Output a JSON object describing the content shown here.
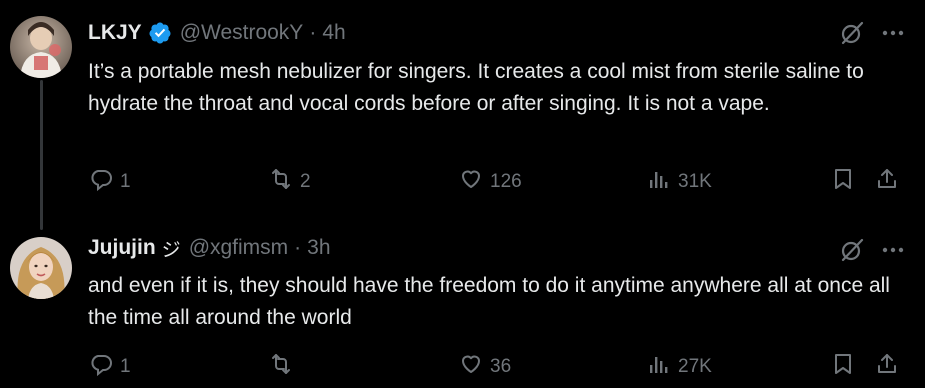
{
  "tweets": [
    {
      "display_name": "LKJY",
      "name_suffix": "",
      "verified": true,
      "handle": "@WestrookY",
      "separator": "·",
      "time": "4h",
      "text": "It’s a portable mesh nebulizer for singers. It creates a cool mist from sterile saline to hydrate the throat and vocal cords before or after singing. It is not a vape.",
      "replies": "1",
      "reposts": "2",
      "likes": "126",
      "views": "31K",
      "icons": [
        "reply-icon",
        "repost-icon",
        "like-icon",
        "views-icon",
        "bookmark-icon",
        "share-icon",
        "grok-icon",
        "more-icon",
        "verified-badge-icon"
      ]
    },
    {
      "display_name": "Jujujin",
      "name_suffix": "ジ",
      "verified": false,
      "handle": "@xgfimsm",
      "separator": "·",
      "time": "3h",
      "text": "and even if it is, they should have the freedom to do it anytime anywhere all at once all the time all around the world",
      "replies": "1",
      "reposts": "",
      "likes": "36",
      "views": "27K",
      "icons": [
        "reply-icon",
        "repost-icon",
        "like-icon",
        "views-icon",
        "bookmark-icon",
        "share-icon",
        "grok-icon",
        "more-icon"
      ]
    }
  ],
  "colors": {
    "background": "#000000",
    "text_primary": "#e7e9ea",
    "text_secondary": "#71767b",
    "verified_blue": "#1d9bf0",
    "thread_line": "#333639"
  }
}
